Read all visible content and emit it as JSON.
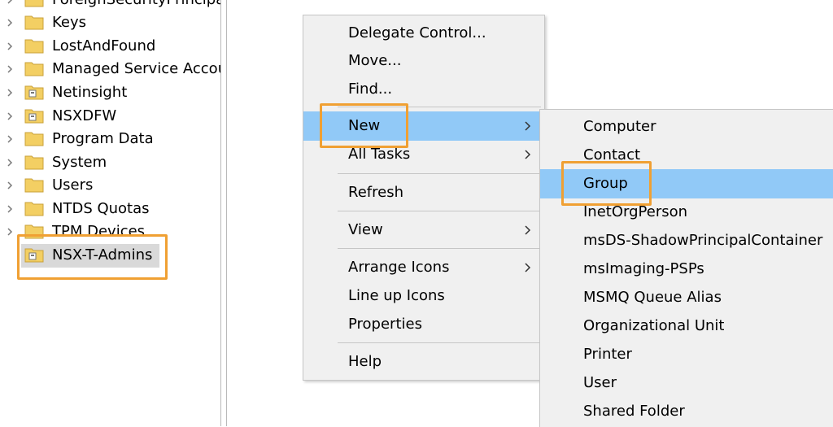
{
  "tree": {
    "items": [
      {
        "label": "ForeignSecurityPrincipals",
        "icon": "folder-icon"
      },
      {
        "label": "Keys",
        "icon": "folder-icon"
      },
      {
        "label": "LostAndFound",
        "icon": "folder-icon"
      },
      {
        "label": "Managed Service Accour",
        "icon": "folder-icon"
      },
      {
        "label": "Netinsight",
        "icon": "ou-folder-icon"
      },
      {
        "label": "NSXDFW",
        "icon": "ou-folder-icon"
      },
      {
        "label": "Program Data",
        "icon": "folder-icon"
      },
      {
        "label": "System",
        "icon": "folder-icon"
      },
      {
        "label": "Users",
        "icon": "folder-icon"
      },
      {
        "label": "NTDS Quotas",
        "icon": "folder-icon"
      },
      {
        "label": "TPM Devices",
        "icon": "folder-icon"
      },
      {
        "label": "NSX-T-Admins",
        "icon": "ou-folder-icon",
        "selected": true
      }
    ]
  },
  "context_menu": {
    "items": [
      {
        "label": "Delegate Control..."
      },
      {
        "label": "Move..."
      },
      {
        "label": "Find..."
      },
      {
        "label": "New",
        "submenu": true,
        "hover": true
      },
      {
        "label": "All Tasks",
        "submenu": true
      },
      {
        "label": "Refresh"
      },
      {
        "label": "View",
        "submenu": true
      },
      {
        "label": "Arrange Icons",
        "submenu": true
      },
      {
        "label": "Line up Icons"
      },
      {
        "label": "Properties"
      },
      {
        "label": "Help"
      }
    ]
  },
  "new_submenu": {
    "items": [
      {
        "label": "Computer"
      },
      {
        "label": "Contact"
      },
      {
        "label": "Group",
        "hover": true
      },
      {
        "label": "InetOrgPerson"
      },
      {
        "label": "msDS-ShadowPrincipalContainer"
      },
      {
        "label": "msImaging-PSPs"
      },
      {
        "label": "MSMQ Queue Alias"
      },
      {
        "label": "Organizational Unit"
      },
      {
        "label": "Printer"
      },
      {
        "label": "User"
      },
      {
        "label": "Shared Folder"
      }
    ]
  },
  "colors": {
    "highlight_box": "#f0a033",
    "menu_hover": "#91c9f7",
    "menu_bg": "#f0f0f0",
    "selection": "#d9d9d9",
    "folder": "#f3cf63"
  }
}
